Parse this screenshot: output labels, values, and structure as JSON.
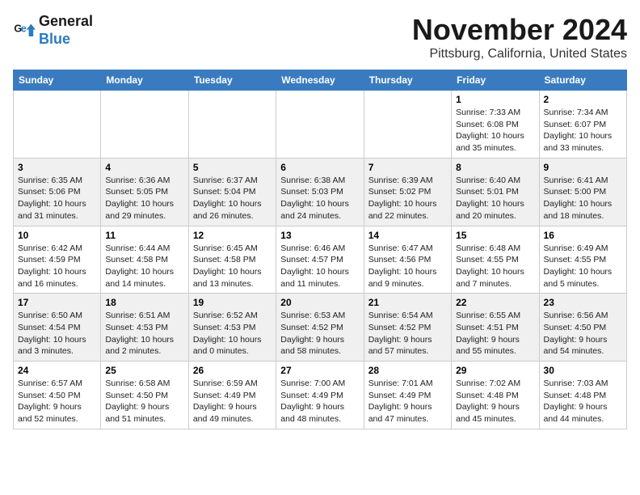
{
  "header": {
    "logo_line1": "General",
    "logo_line2": "Blue",
    "month_title": "November 2024",
    "location": "Pittsburg, California, United States"
  },
  "days_of_week": [
    "Sunday",
    "Monday",
    "Tuesday",
    "Wednesday",
    "Thursday",
    "Friday",
    "Saturday"
  ],
  "weeks": [
    [
      {
        "num": "",
        "info": ""
      },
      {
        "num": "",
        "info": ""
      },
      {
        "num": "",
        "info": ""
      },
      {
        "num": "",
        "info": ""
      },
      {
        "num": "",
        "info": ""
      },
      {
        "num": "1",
        "info": "Sunrise: 7:33 AM\nSunset: 6:08 PM\nDaylight: 10 hours and 35 minutes."
      },
      {
        "num": "2",
        "info": "Sunrise: 7:34 AM\nSunset: 6:07 PM\nDaylight: 10 hours and 33 minutes."
      }
    ],
    [
      {
        "num": "3",
        "info": "Sunrise: 6:35 AM\nSunset: 5:06 PM\nDaylight: 10 hours and 31 minutes."
      },
      {
        "num": "4",
        "info": "Sunrise: 6:36 AM\nSunset: 5:05 PM\nDaylight: 10 hours and 29 minutes."
      },
      {
        "num": "5",
        "info": "Sunrise: 6:37 AM\nSunset: 5:04 PM\nDaylight: 10 hours and 26 minutes."
      },
      {
        "num": "6",
        "info": "Sunrise: 6:38 AM\nSunset: 5:03 PM\nDaylight: 10 hours and 24 minutes."
      },
      {
        "num": "7",
        "info": "Sunrise: 6:39 AM\nSunset: 5:02 PM\nDaylight: 10 hours and 22 minutes."
      },
      {
        "num": "8",
        "info": "Sunrise: 6:40 AM\nSunset: 5:01 PM\nDaylight: 10 hours and 20 minutes."
      },
      {
        "num": "9",
        "info": "Sunrise: 6:41 AM\nSunset: 5:00 PM\nDaylight: 10 hours and 18 minutes."
      }
    ],
    [
      {
        "num": "10",
        "info": "Sunrise: 6:42 AM\nSunset: 4:59 PM\nDaylight: 10 hours and 16 minutes."
      },
      {
        "num": "11",
        "info": "Sunrise: 6:44 AM\nSunset: 4:58 PM\nDaylight: 10 hours and 14 minutes."
      },
      {
        "num": "12",
        "info": "Sunrise: 6:45 AM\nSunset: 4:58 PM\nDaylight: 10 hours and 13 minutes."
      },
      {
        "num": "13",
        "info": "Sunrise: 6:46 AM\nSunset: 4:57 PM\nDaylight: 10 hours and 11 minutes."
      },
      {
        "num": "14",
        "info": "Sunrise: 6:47 AM\nSunset: 4:56 PM\nDaylight: 10 hours and 9 minutes."
      },
      {
        "num": "15",
        "info": "Sunrise: 6:48 AM\nSunset: 4:55 PM\nDaylight: 10 hours and 7 minutes."
      },
      {
        "num": "16",
        "info": "Sunrise: 6:49 AM\nSunset: 4:55 PM\nDaylight: 10 hours and 5 minutes."
      }
    ],
    [
      {
        "num": "17",
        "info": "Sunrise: 6:50 AM\nSunset: 4:54 PM\nDaylight: 10 hours and 3 minutes."
      },
      {
        "num": "18",
        "info": "Sunrise: 6:51 AM\nSunset: 4:53 PM\nDaylight: 10 hours and 2 minutes."
      },
      {
        "num": "19",
        "info": "Sunrise: 6:52 AM\nSunset: 4:53 PM\nDaylight: 10 hours and 0 minutes."
      },
      {
        "num": "20",
        "info": "Sunrise: 6:53 AM\nSunset: 4:52 PM\nDaylight: 9 hours and 58 minutes."
      },
      {
        "num": "21",
        "info": "Sunrise: 6:54 AM\nSunset: 4:52 PM\nDaylight: 9 hours and 57 minutes."
      },
      {
        "num": "22",
        "info": "Sunrise: 6:55 AM\nSunset: 4:51 PM\nDaylight: 9 hours and 55 minutes."
      },
      {
        "num": "23",
        "info": "Sunrise: 6:56 AM\nSunset: 4:50 PM\nDaylight: 9 hours and 54 minutes."
      }
    ],
    [
      {
        "num": "24",
        "info": "Sunrise: 6:57 AM\nSunset: 4:50 PM\nDaylight: 9 hours and 52 minutes."
      },
      {
        "num": "25",
        "info": "Sunrise: 6:58 AM\nSunset: 4:50 PM\nDaylight: 9 hours and 51 minutes."
      },
      {
        "num": "26",
        "info": "Sunrise: 6:59 AM\nSunset: 4:49 PM\nDaylight: 9 hours and 49 minutes."
      },
      {
        "num": "27",
        "info": "Sunrise: 7:00 AM\nSunset: 4:49 PM\nDaylight: 9 hours and 48 minutes."
      },
      {
        "num": "28",
        "info": "Sunrise: 7:01 AM\nSunset: 4:49 PM\nDaylight: 9 hours and 47 minutes."
      },
      {
        "num": "29",
        "info": "Sunrise: 7:02 AM\nSunset: 4:48 PM\nDaylight: 9 hours and 45 minutes."
      },
      {
        "num": "30",
        "info": "Sunrise: 7:03 AM\nSunset: 4:48 PM\nDaylight: 9 hours and 44 minutes."
      }
    ]
  ]
}
